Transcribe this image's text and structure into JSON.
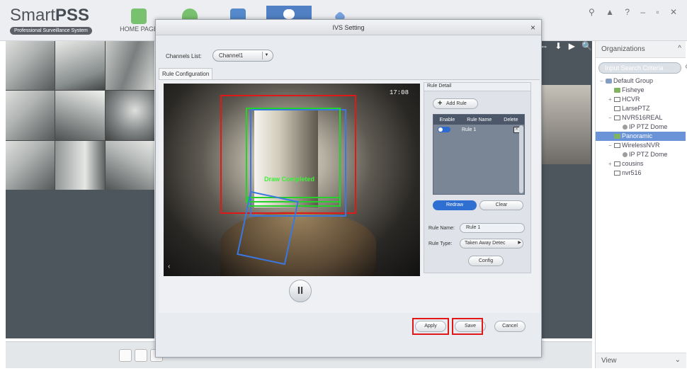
{
  "app": {
    "logo_name_plain": "Smart",
    "logo_name_bold": "PSS",
    "logo_sub": "Professional Surveillance System",
    "home_tab_label": "HOME PAGE",
    "window_controls": "⚲ ▲ ? – ▫ ✕"
  },
  "video_toolbar": "⇔ ⬇ ▶ 🔍 ✕",
  "organizations": {
    "title": "Organizations",
    "search_placeholder": "Input Search Criteria",
    "tree": [
      {
        "toggle": "−",
        "icon": "group",
        "label": "Default Group",
        "indent": 0
      },
      {
        "toggle": "",
        "icon": "cam",
        "label": "Fisheye",
        "indent": 1
      },
      {
        "toggle": "+",
        "icon": "dev",
        "label": "HCVR",
        "indent": 1
      },
      {
        "toggle": "",
        "icon": "dev",
        "label": "LarsePTZ",
        "indent": 1
      },
      {
        "toggle": "−",
        "icon": "dev",
        "label": "NVR516REAL",
        "indent": 1
      },
      {
        "toggle": "",
        "icon": "ptz",
        "label": "IP PTZ Dome",
        "indent": 2
      },
      {
        "toggle": "",
        "icon": "cam",
        "label": "Panoramic",
        "indent": 1,
        "selected": true
      },
      {
        "toggle": "−",
        "icon": "dev",
        "label": "WirelessNVR",
        "indent": 1
      },
      {
        "toggle": "",
        "icon": "ptz",
        "label": "IP PTZ Dome",
        "indent": 2
      },
      {
        "toggle": "+",
        "icon": "dev",
        "label": "cousins",
        "indent": 1
      },
      {
        "toggle": "",
        "icon": "dev",
        "label": "nvr516",
        "indent": 1
      }
    ],
    "footer": "View"
  },
  "dialog": {
    "title": "IVS Setting",
    "channels_label": "Channels List:",
    "channel_value": "Channel1",
    "tab_label": "Rule Configuration",
    "timestamp": "17:08",
    "draw_status": "Draw Completed",
    "rule_detail": {
      "title": "Rule Detail",
      "add_rule": "Add Rule",
      "columns": [
        "Enable",
        "Rule Name",
        "Delete"
      ],
      "rows": [
        {
          "enabled": true,
          "name": "Rule 1"
        }
      ],
      "redraw": "Redraw",
      "clear": "Clear",
      "rule_name_label": "Rule Name:",
      "rule_name_value": "Rule 1",
      "rule_type_label": "Rule Type:",
      "rule_type_value": "Taken Away Detec",
      "config": "Config"
    },
    "apply": "Apply",
    "save": "Save",
    "cancel": "Cancel"
  },
  "colors": {
    "highlight": "#e01818",
    "accent": "#2f6fd2",
    "draw_green": "#27d12b"
  }
}
